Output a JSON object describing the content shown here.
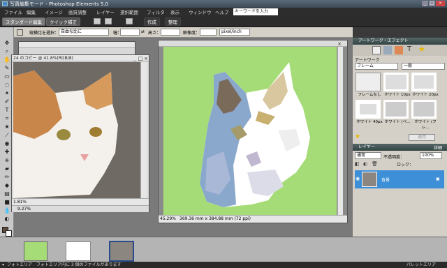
{
  "app": {
    "title": "写真編集モード - Photoshop Elements 5.0"
  },
  "menus": [
    "ファイル",
    "編集",
    "イメージ",
    "画質調整",
    "レイヤー",
    "選択範囲",
    "フィルタ",
    "表示",
    "ウィンドウ",
    "ヘルプ"
  ],
  "search": {
    "value": "キーワードを入力"
  },
  "mode": {
    "standard": "スタンダード編集",
    "quick": "クイック補正",
    "create": "作成",
    "organize": "整理"
  },
  "options": {
    "ratio_label": "縦横比を選択：",
    "ratio_value": "自由な比に",
    "width_label": "幅：",
    "height_label": "高さ：",
    "resolution_label": "解像度：",
    "unit": "pixel/inch"
  },
  "doc1": {
    "title": "24 のコピー @ 41.8%(RGB/8)",
    "zoom": "1.81%",
    "zoom2": "9.27%"
  },
  "doc2": {
    "zoom": "45.29%",
    "size": "369.36 mm x 384.88 mm (72 ppi)"
  },
  "artwork_panel": {
    "title": "アートワーク・エフェクト",
    "section": "アートワーク",
    "category": "フレーム",
    "filter": "一般",
    "items": [
      "フレームなし",
      "ホワイト 10px",
      "ホワイト 20px",
      "ホワイト 40px",
      "ホワイト (ベ...",
      "ホワイト (フレ..."
    ],
    "apply": "適用"
  },
  "layers_panel": {
    "title": "レイヤー",
    "more": "詳細",
    "blend": "通常",
    "opacity_label": "不透明度：",
    "opacity": "100%",
    "lock_label": "ロック：",
    "layer_name": "背景"
  },
  "status": {
    "text": "フォトエリア内に 3 個のファイルがあります",
    "bin_label": "フォトエリア",
    "palette": "パレットエリア"
  },
  "colors": {
    "accent": "#3d8fd8",
    "green_bg": "#a6dc78"
  }
}
